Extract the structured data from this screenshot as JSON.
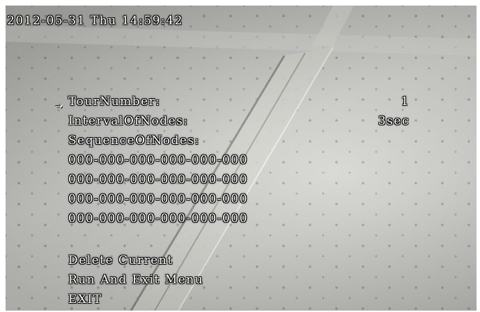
{
  "osd": {
    "timestamp": "2012-05-31 Thu 14:59:42"
  },
  "tour_menu": {
    "pointer": "→",
    "tour_number_label": "TourNumber:",
    "tour_number_value": "1",
    "interval_label": "IntervalOfNodes:",
    "interval_value": "3sec",
    "sequence_label": "SequenceOfNodes:",
    "sequences": [
      "000-000-000-000-000-000",
      "000-000-000-000-000-000",
      "000-000-000-000-000-000",
      "000-000-000-000-000-000"
    ],
    "delete_current": "Delete Current",
    "run_and_exit": "Run And Exit Menu",
    "exit": "EXIT"
  }
}
